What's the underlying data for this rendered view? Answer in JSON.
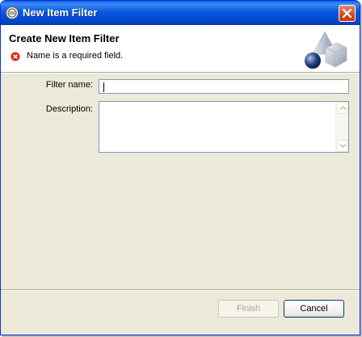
{
  "window": {
    "title": "New Item Filter"
  },
  "header": {
    "title": "Create New Item Filter",
    "error_message": "Name is a required field."
  },
  "form": {
    "filter_name_label": "Filter name:",
    "filter_name_value": "",
    "description_label": "Description:",
    "description_value": ""
  },
  "buttons": {
    "finish_label": "Finish",
    "finish_enabled": false,
    "cancel_label": "Cancel"
  },
  "colors": {
    "titlebar": "#0a5ae0",
    "dialog_background": "#ece9d8",
    "error_icon": "#d9291c",
    "close_button": "#d44a1f"
  },
  "icons": {
    "app": "eclipse-app-icon",
    "close": "close-icon",
    "error": "error-icon",
    "banner": "wizard-shapes-icon"
  }
}
